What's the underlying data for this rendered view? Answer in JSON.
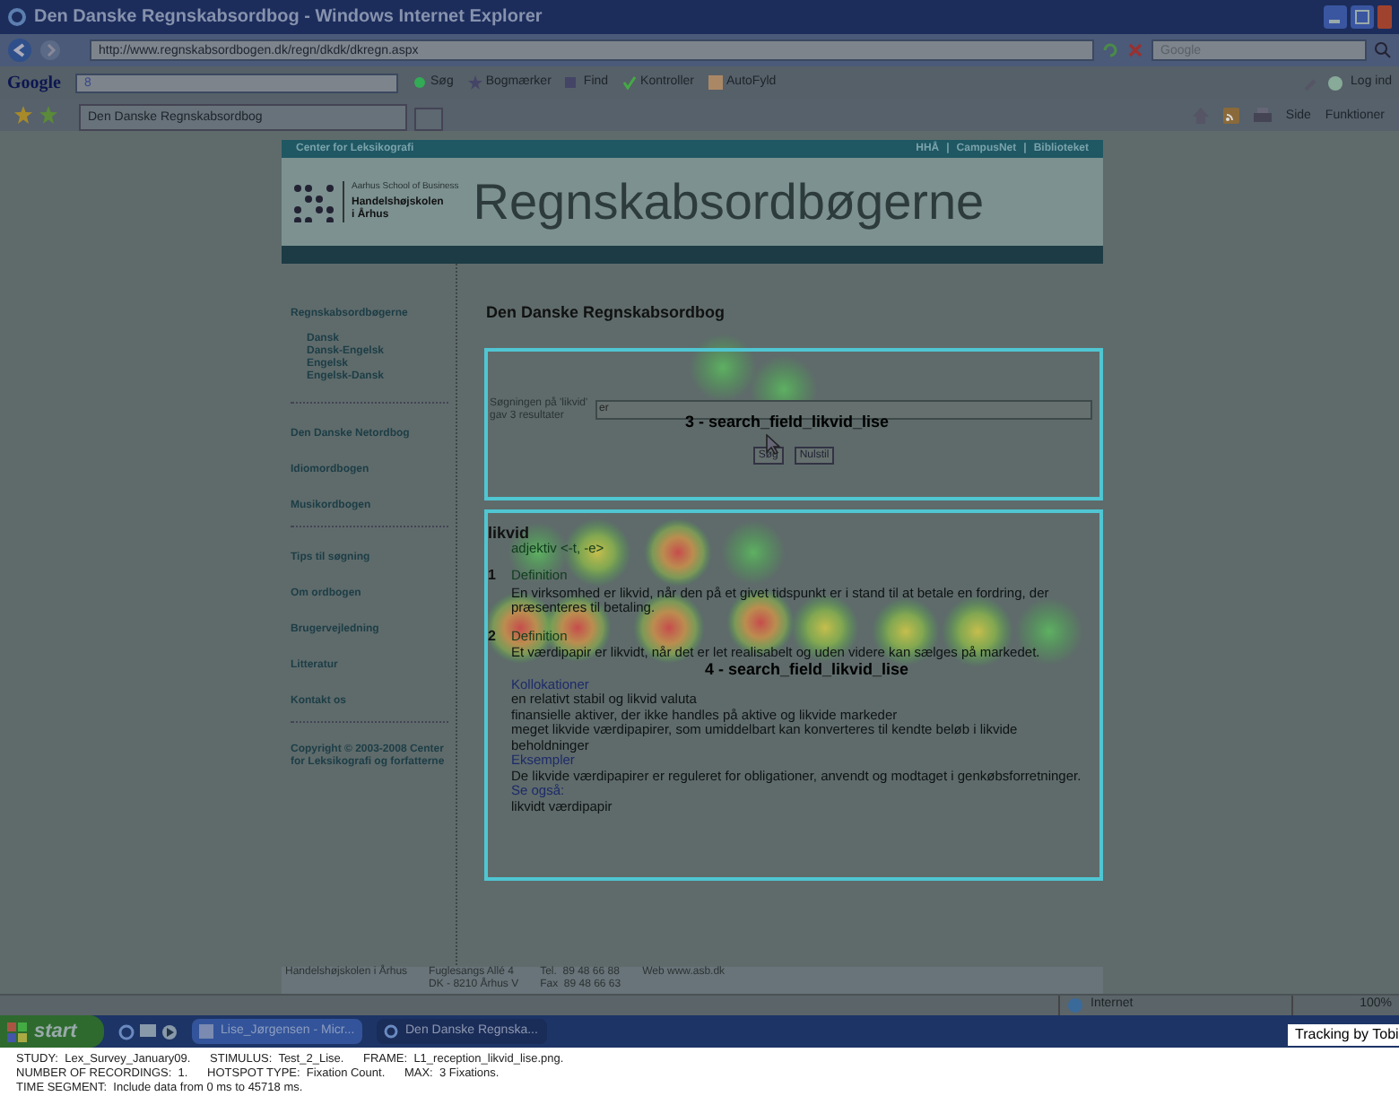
{
  "window": {
    "title": "Den Danske Regnskabsordbog - Windows Internet Explorer"
  },
  "address_bar": {
    "url": "http://www.regnskabsordbogen.dk/regn/dkdk/dkregn.aspx",
    "search_placeholder": "Google"
  },
  "google_toolbar": {
    "logo": "Google",
    "field_value": "8",
    "items": [
      "Søg",
      "Bogmærker",
      "Find",
      "Kontroller",
      "AutoFyld"
    ],
    "login": "Log ind"
  },
  "tab": {
    "label": "Den Danske Regnskabsordbog"
  },
  "command_bar": [
    "Side",
    "Funktioner"
  ],
  "site": {
    "top_left": "Center for Leksikografi",
    "top_links": [
      "HHÅ",
      "CampusNet",
      "Biblioteket"
    ],
    "top_links_separator": "|",
    "logo_lines": [
      "Aarhus School of Business",
      "Handelshøjskolen",
      "i Århus"
    ],
    "banner_title": "Regnskabsordbøgerne",
    "nav": {
      "heading": "Regnskabsordbøgerne",
      "sub_items": [
        "Dansk",
        "Dansk-Engelsk",
        "Engelsk",
        "Engelsk-Dansk"
      ],
      "groups": [
        [
          "Den Danske Netordbog",
          "Idiomordbogen",
          "Musikordbogen"
        ],
        [
          "Tips til søgning",
          "Om ordbogen",
          "Brugervejledning",
          "Litteratur",
          "Kontakt os"
        ]
      ],
      "copyright": "Copyright © 2003-2008 Center for Leksikografi og forfatterne"
    },
    "page_title": "Den Danske Regnskabsordbog",
    "search": {
      "result_text": "Søgningen på 'likvid' gav 3 resultater",
      "field_value": "er",
      "buttons": [
        "Søg",
        "Nulstil"
      ],
      "aoi_label": "3 - search_field_likvid_lise"
    },
    "entry": {
      "headword": "likvid",
      "grammar": "adjektiv <-t, -e>",
      "senses": [
        {
          "number": "1",
          "label": "Definition",
          "text": "En virksomhed er likvid, når den på et givet tidspunkt er i stand til at betale en fordring, der præsenteres til betaling."
        },
        {
          "number": "2",
          "label": "Definition",
          "text": "Et værdipapir er likvidt, når det er let realisabelt og uden videre kan sælges på markedet.",
          "aoi_label": "4 - search_field_likvid_lise",
          "sections": [
            {
              "heading": "Kollokationer",
              "lines": [
                "en relativt stabil og likvid valuta",
                "finansielle aktiver, der ikke handles på aktive og likvide markeder",
                "meget likvide værdipapirer, som umiddelbart kan konverteres til kendte beløb i likvide beholdninger"
              ]
            },
            {
              "heading": "Eksempler",
              "lines": [
                "De likvide værdipapirer er reguleret for obligationer, anvendt og modtaget i genkøbsforretninger."
              ]
            },
            {
              "heading": "Se også:",
              "lines": [
                "likvidt værdipapir"
              ]
            }
          ]
        }
      ]
    },
    "footer": [
      [
        "Handelshøjskolen i Århus"
      ],
      [
        "Fuglesangs Allé 4",
        "DK - 8210 Århus V"
      ],
      [
        "Tel.  89 48 66 88",
        "Fax  89 48 66 63"
      ],
      [
        "Web www.asb.dk"
      ]
    ]
  },
  "status_bar": {
    "zone": "Internet",
    "zoom": "100%"
  },
  "taskbar": {
    "start": "start",
    "tasks": [
      {
        "label": "Lise_Jørgensen - Micr...",
        "selected": false
      },
      {
        "label": "Den Danske Regnska...",
        "selected": true
      }
    ],
    "tracking": "Tracking by Tobi"
  },
  "study_info": [
    "STUDY:  Lex_Survey_January09.      STIMULUS:  Test_2_Lise.      FRAME:  L1_reception_likvid_lise.png.",
    "NUMBER OF RECORDINGS:  1.      HOTSPOT TYPE:  Fixation Count.      MAX:  3 Fixations.",
    "TIME SEGMENT:  Include data from 0 ms to 45718 ms."
  ]
}
